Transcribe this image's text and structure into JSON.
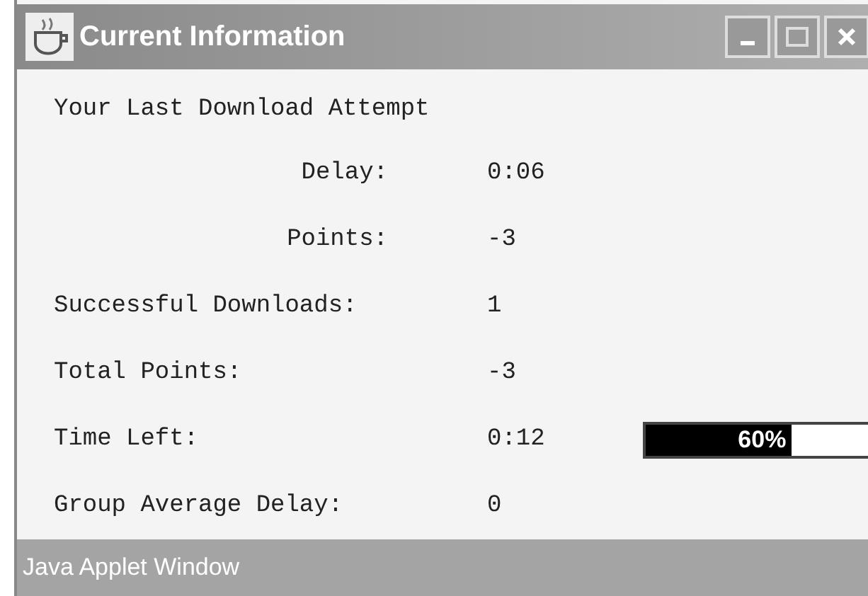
{
  "window": {
    "title": "Current Information"
  },
  "heading": "Your Last Download Attempt",
  "rows": [
    {
      "kind": "sub",
      "label": "Delay:",
      "value": "0:06"
    },
    {
      "kind": "sub",
      "label": "Points:",
      "value": "-3"
    },
    {
      "kind": "main",
      "label": "Successful Downloads:",
      "value": "1"
    },
    {
      "kind": "main",
      "label": "Total Points:",
      "value": "-3"
    },
    {
      "kind": "progress",
      "label": "Time Left:",
      "value": "0:12",
      "progress": {
        "level": 0.6,
        "reading": "60%"
      }
    },
    {
      "kind": "main",
      "label": "Group Average Delay:",
      "value": "0"
    }
  ],
  "status_bar": "Java Applet Window"
}
